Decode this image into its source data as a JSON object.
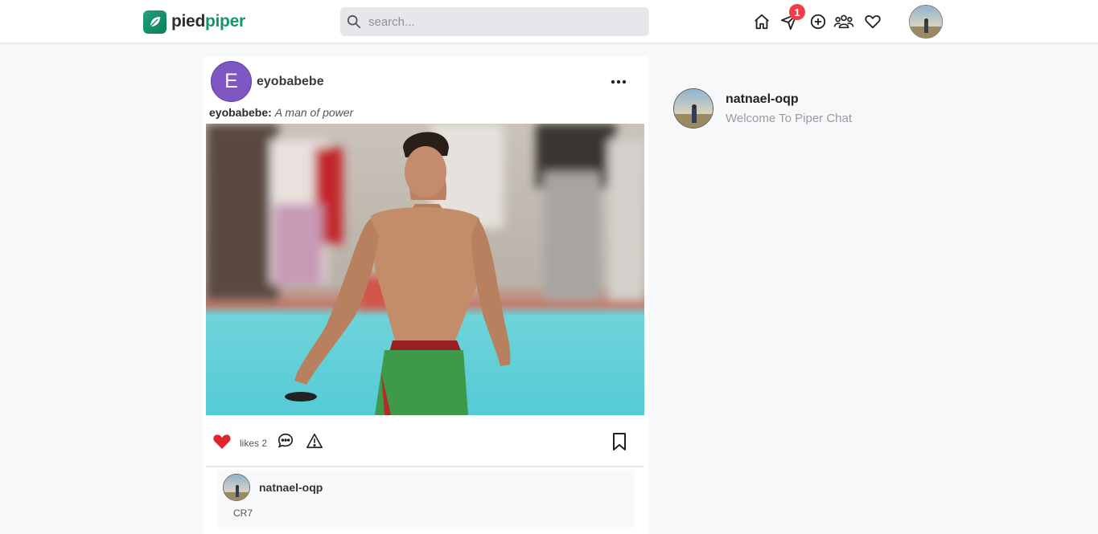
{
  "header": {
    "logo_part1": "pied",
    "logo_part2": "piper",
    "search_placeholder": "search...",
    "notification_count": "1",
    "icons": [
      "home-icon",
      "send-icon",
      "add-circle-icon",
      "people-icon",
      "heart-icon"
    ]
  },
  "post": {
    "username": "eyobabebe",
    "avatar_letter": "E",
    "caption_user": "eyobabebe:",
    "caption_text": "A man of power",
    "likes_text": "likes 2",
    "comment": {
      "username": "natnael-oqp",
      "text": "CR7"
    }
  },
  "profile": {
    "username": "natnael-oqp",
    "subtitle": "Welcome To Piper Chat"
  },
  "colors": {
    "brand": "#13956b",
    "like": "#e0242f",
    "badge": "#ef3e46",
    "avatar_bg": "#7e57c2"
  }
}
